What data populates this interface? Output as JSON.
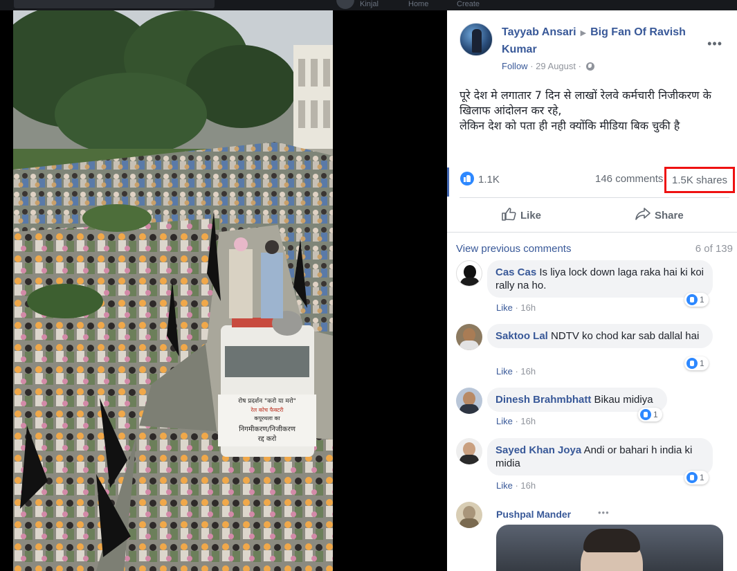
{
  "topbar": {
    "user": "Kinjal",
    "home": "Home",
    "create": "Create"
  },
  "post": {
    "author": "Tayyab Ansari",
    "group": "Big Fan Of Ravish Kumar",
    "follow": "Follow",
    "date": "29 August",
    "text_line1": "पूरे देश मे लगातार 7 दिन से लाखों रेलवे कर्मचारी निजीकरण के खिलाफ आंदोलन कर रहे,",
    "text_line2": "लेकिन देश को पता ही नही क्योंकि मीडिया बिक चुकी है",
    "likes": "1.1K",
    "comments": "146 comments",
    "shares": "1.5K shares",
    "like_action": "Like",
    "share_action": "Share"
  },
  "comments_header": {
    "previous": "View previous comments",
    "count": "6 of 139"
  },
  "comments": [
    {
      "name": "Cas Cas",
      "text": "Is liya lock down laga raka hai ki koi rally na ho.",
      "like": "Like",
      "time": "16h",
      "reactions": "1"
    },
    {
      "name": "Saktoo Lal",
      "text": "NDTV ko chod kar sab dallal hai",
      "like": "Like",
      "time": "16h",
      "reactions": "1"
    },
    {
      "name": "Dinesh Brahmbhatt",
      "text": "Bikau midiya",
      "like": "Like",
      "time": "16h",
      "reactions": "1"
    },
    {
      "name": "Sayed Khan Joya",
      "text": "Andi or bahari h india ki midia",
      "like": "Like",
      "time": "16h",
      "reactions": "1"
    },
    {
      "name": "Pushpal Mander"
    }
  ],
  "banner": {
    "line1": "राेष प्रदर्शन \"करो या मरो\"",
    "line2": "रेल कोच फैक्टरी",
    "line3": "कपूरथला का",
    "line4": "निगमीकरण/निजीकरण",
    "line5": "रद्द करो"
  },
  "colors": {
    "link": "#385898",
    "highlight": "#ee1111",
    "reaction": "#2d88ff"
  }
}
